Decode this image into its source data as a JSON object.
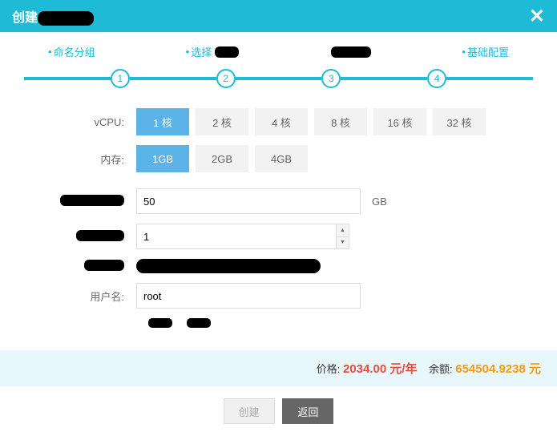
{
  "header": {
    "title_prefix": "创建"
  },
  "steps": {
    "items": [
      {
        "label": "命名分组",
        "num": "1"
      },
      {
        "label": "选择",
        "num": "2",
        "redacted_suffix": true
      },
      {
        "label": "",
        "num": "3",
        "redacted_full": true
      },
      {
        "label": "基础配置",
        "num": "4"
      }
    ]
  },
  "form": {
    "vcpu": {
      "label": "vCPU:",
      "options": [
        "1 核",
        "2 核",
        "4 核",
        "8 核",
        "16 核",
        "32 核"
      ],
      "selected": "1 核"
    },
    "memory": {
      "label": "内存:",
      "options": [
        "1GB",
        "2GB",
        "4GB"
      ],
      "selected": "1GB"
    },
    "disk": {
      "value": "50",
      "unit": "GB"
    },
    "count": {
      "value": "1"
    },
    "username": {
      "label": "用户名:",
      "value": "root"
    }
  },
  "price": {
    "price_label": "价格:",
    "price_value": "2034.00 元/年",
    "balance_label": "余额:",
    "balance_value": "654504.9238 元"
  },
  "footer": {
    "create": "创建",
    "back": "返回"
  }
}
